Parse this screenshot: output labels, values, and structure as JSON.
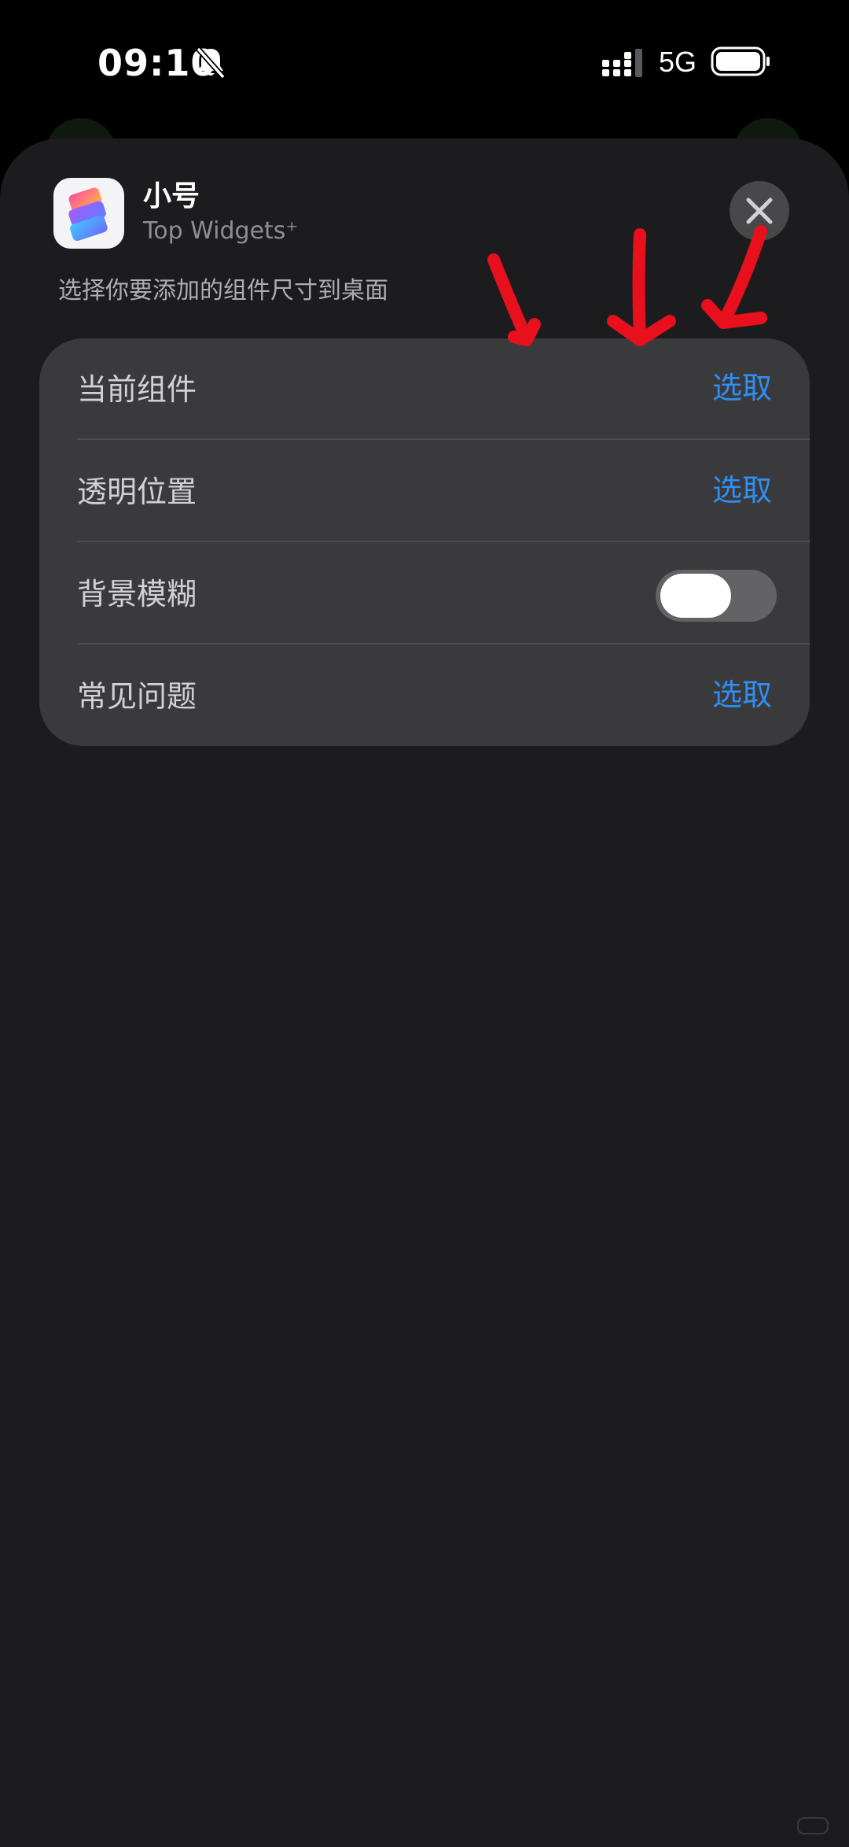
{
  "status_bar": {
    "time": "09:10",
    "network": "5G",
    "icons": [
      "bell-slash-icon",
      "signal-icon",
      "battery-icon"
    ]
  },
  "sheet": {
    "app_title": "小号",
    "app_subtitle": "Top Widgets⁺",
    "instruction": "选择你要添加的组件尺寸到桌面",
    "close_icon": "close-icon"
  },
  "settings": {
    "rows": [
      {
        "label": "当前组件",
        "action": "选取"
      },
      {
        "label": "透明位置",
        "action": "选取"
      },
      {
        "label": "背景模糊",
        "toggle_on": false
      },
      {
        "label": "常见问题",
        "action": "选取"
      }
    ]
  },
  "colors": {
    "accent": "#2f8ff2",
    "sheet_bg": "#1c1c1e",
    "card_bg": "#3a3a3c",
    "annotation": "#e8101c"
  }
}
